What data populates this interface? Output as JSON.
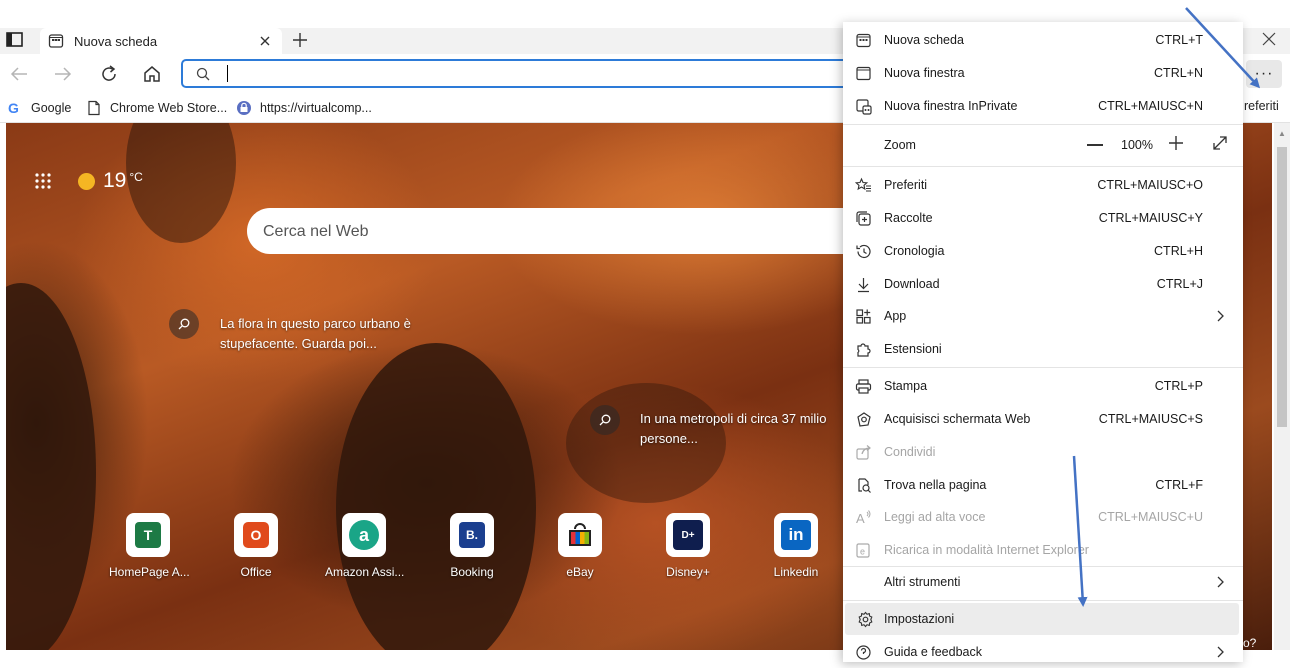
{
  "tab": {
    "title": "Nuova scheda"
  },
  "address": {
    "placeholder": ""
  },
  "favorites_bar": {
    "items": [
      "Google",
      "Chrome Web Store...",
      "https://virtualcomp..."
    ],
    "right_label": "referiti"
  },
  "weather": {
    "temp": "19",
    "unit": "°C"
  },
  "web_search": {
    "placeholder": "Cerca nel Web"
  },
  "hotspots": [
    {
      "text_line1": "La flora in questo parco urbano è",
      "text_line2": "stupefacente. Guarda poi..."
    },
    {
      "text_line1": "In una metropoli di circa 37 milio",
      "text_line2": "persone..."
    }
  ],
  "quick_links": [
    {
      "label": "HomePage A...",
      "letter": "T",
      "color": "#1d7a45"
    },
    {
      "label": "Office",
      "letter": "O",
      "color": "#e04a1c"
    },
    {
      "label": "Amazon Assi...",
      "letter": "a",
      "color": "#1aa587"
    },
    {
      "label": "Booking",
      "letter": "B.",
      "color": "#1b3f8f"
    },
    {
      "label": "eBay",
      "letter": "",
      "color": "#e53238"
    },
    {
      "label": "Disney+",
      "letter": "D+",
      "color": "#0f1e4e"
    },
    {
      "label": "Linkedin",
      "letter": "in",
      "color": "#0a66c2"
    }
  ],
  "behind_text": "o?",
  "menu": {
    "items": [
      {
        "label": "Nuova scheda",
        "shortcut": "CTRL+T",
        "icon": "new-tab-icon"
      },
      {
        "label": "Nuova finestra",
        "shortcut": "CTRL+N",
        "icon": "new-window-icon"
      },
      {
        "label": "Nuova finestra InPrivate",
        "shortcut": "CTRL+MAIUSC+N",
        "icon": "inprivate-icon"
      },
      {
        "label": "Zoom",
        "shortcut": "",
        "icon": ""
      },
      {
        "label": "Preferiti",
        "shortcut": "CTRL+MAIUSC+O",
        "icon": "favorites-icon"
      },
      {
        "label": "Raccolte",
        "shortcut": "CTRL+MAIUSC+Y",
        "icon": "collections-icon"
      },
      {
        "label": "Cronologia",
        "shortcut": "CTRL+H",
        "icon": "history-icon"
      },
      {
        "label": "Download",
        "shortcut": "CTRL+J",
        "icon": "download-icon"
      },
      {
        "label": "App",
        "shortcut": "",
        "icon": "apps-icon"
      },
      {
        "label": "Estensioni",
        "shortcut": "",
        "icon": "extensions-icon"
      },
      {
        "label": "Stampa",
        "shortcut": "CTRL+P",
        "icon": "print-icon"
      },
      {
        "label": "Acquisisci schermata Web",
        "shortcut": "CTRL+MAIUSC+S",
        "icon": "web-capture-icon"
      },
      {
        "label": "Condividi",
        "shortcut": "",
        "icon": "share-icon"
      },
      {
        "label": "Trova nella pagina",
        "shortcut": "CTRL+F",
        "icon": "find-icon"
      },
      {
        "label": "Leggi ad alta voce",
        "shortcut": "CTRL+MAIUSC+U",
        "icon": "read-aloud-icon"
      },
      {
        "label": "Ricarica in modalità Internet Explorer",
        "shortcut": "",
        "icon": "ie-mode-icon"
      },
      {
        "label": "Altri strumenti",
        "shortcut": "",
        "icon": ""
      },
      {
        "label": "Impostazioni",
        "shortcut": "",
        "icon": "settings-icon"
      },
      {
        "label": "Guida e feedback",
        "shortcut": "",
        "icon": "help-icon"
      }
    ],
    "zoom": {
      "value": "100%"
    }
  },
  "annotation_color": "#4472c4"
}
